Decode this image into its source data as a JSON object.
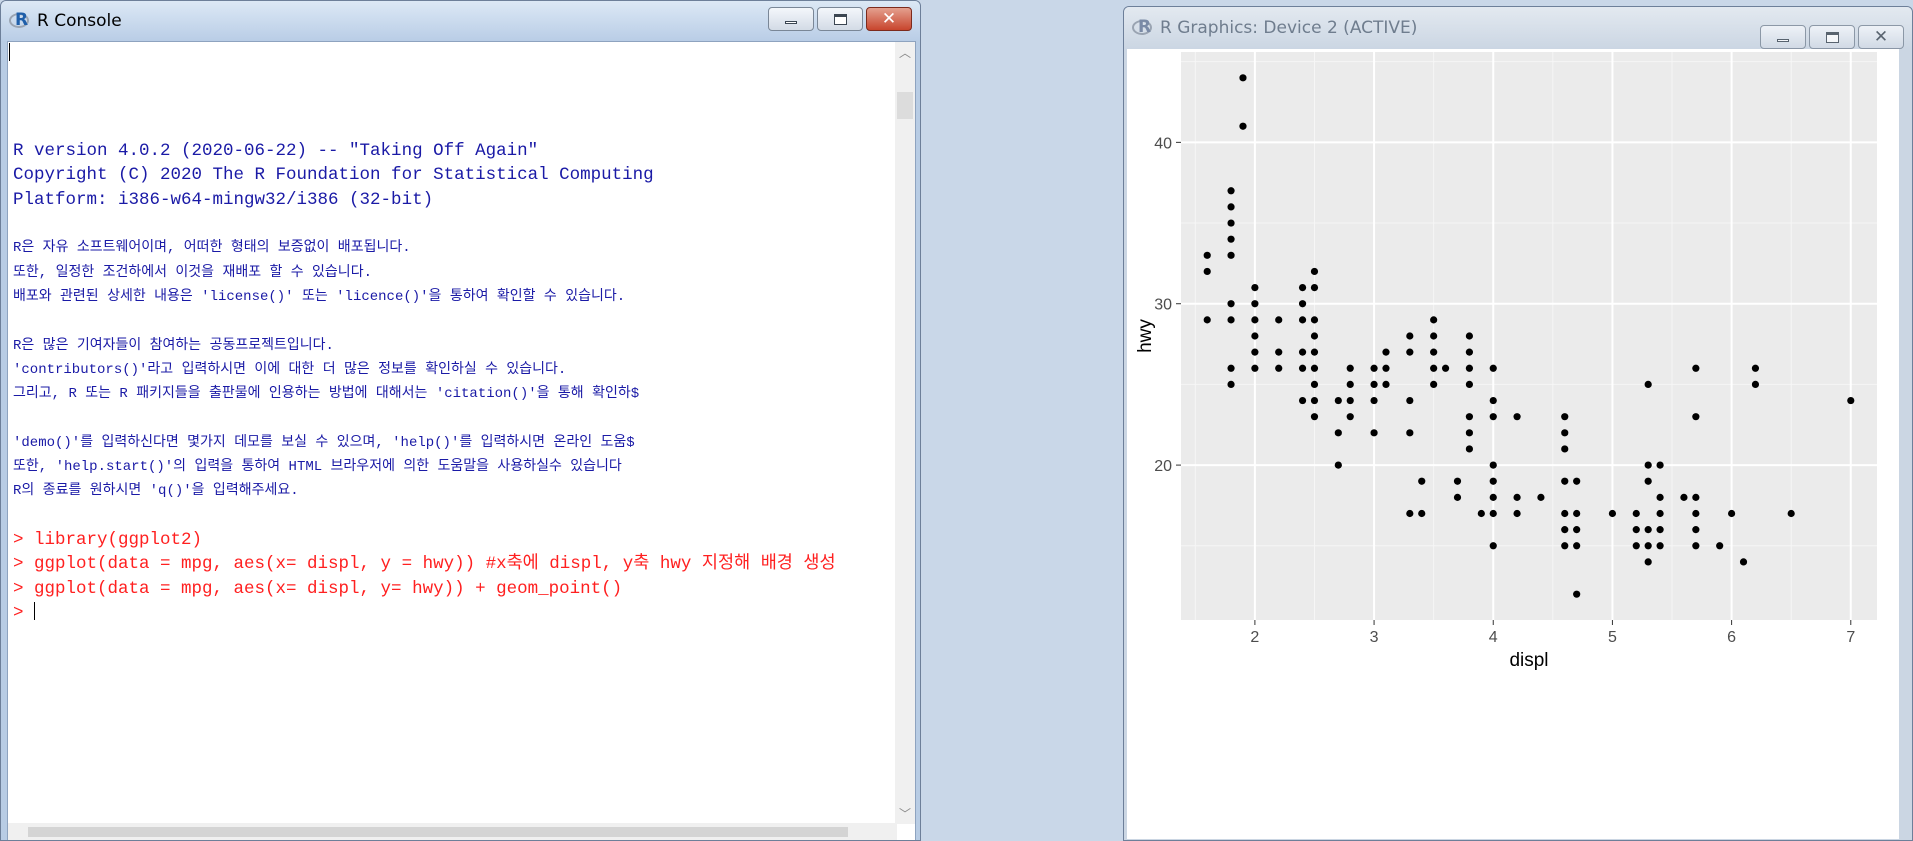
{
  "console_window": {
    "title": "R Console",
    "lines": [
      {
        "text": "",
        "cls": "blue"
      },
      {
        "text": "",
        "cls": "blue"
      },
      {
        "text": "R version 4.0.2 (2020-06-22) -- \"Taking Off Again\"",
        "cls": "blue"
      },
      {
        "text": "Copyright (C) 2020 The R Foundation for Statistical Computing",
        "cls": "blue"
      },
      {
        "text": "Platform: i386-w64-mingw32/i386 (32-bit)",
        "cls": "blue"
      },
      {
        "text": "",
        "cls": "blue"
      },
      {
        "text": "R은 자유 소프트웨어이며, 어떠한 형태의 보증없이 배포됩니다.",
        "cls": "blue small"
      },
      {
        "text": "또한, 일정한 조건하에서 이것을 재배포 할 수 있습니다.",
        "cls": "blue small"
      },
      {
        "text": "배포와 관련된 상세한 내용은 'license()' 또는 'licence()'을 통하여 확인할 수 있습니다.",
        "cls": "blue small"
      },
      {
        "text": "",
        "cls": "blue"
      },
      {
        "text": "R은 많은 기여자들이 참여하는 공동프로젝트입니다.",
        "cls": "blue small"
      },
      {
        "text": "'contributors()'라고 입력하시면 이에 대한 더 많은 정보를 확인하실 수 있습니다.",
        "cls": "blue small"
      },
      {
        "text": "그리고, R 또는 R 패키지들을 출판물에 인용하는 방법에 대해서는 'citation()'을 통해 확인하$",
        "cls": "blue small"
      },
      {
        "text": "",
        "cls": "blue"
      },
      {
        "text": "'demo()'를 입력하신다면 몇가지 데모를 보실 수 있으며, 'help()'를 입력하시면 온라인 도움$",
        "cls": "blue small"
      },
      {
        "text": "또한, 'help.start()'의 입력을 통하여 HTML 브라우저에 의한 도움말을 사용하실수 있습니다",
        "cls": "blue small"
      },
      {
        "text": "R의 종료를 원하시면 'q()'을 입력해주세요.",
        "cls": "blue small"
      },
      {
        "text": "",
        "cls": "blue"
      },
      {
        "text": "> library(ggplot2)",
        "cls": "red"
      },
      {
        "text": "> ggplot(data = mpg, aes(x= displ, y = hwy)) #x축에 displ, y축 hwy 지정해 배경 생성",
        "cls": "red"
      },
      {
        "text": "> ggplot(data = mpg, aes(x= displ, y= hwy)) + geom_point()",
        "cls": "red"
      }
    ],
    "prompt": "> "
  },
  "graphics_window": {
    "title": "R Graphics: Device 2 (ACTIVE)"
  },
  "chart_data": {
    "type": "scatter",
    "title": "",
    "xlabel": "displ",
    "ylabel": "hwy",
    "xlim": [
      1.38,
      7.22
    ],
    "ylim": [
      10.4,
      45.6
    ],
    "xticks": [
      2,
      3,
      4,
      5,
      6,
      7
    ],
    "yticks": [
      20,
      30,
      40
    ],
    "grid": true,
    "panel_background": "#ebebeb",
    "point_color": "#000000",
    "points": [
      [
        1.6,
        29
      ],
      [
        1.6,
        32
      ],
      [
        1.6,
        33
      ],
      [
        1.8,
        25
      ],
      [
        1.8,
        26
      ],
      [
        1.8,
        29
      ],
      [
        1.8,
        30
      ],
      [
        1.8,
        33
      ],
      [
        1.8,
        34
      ],
      [
        1.8,
        35
      ],
      [
        1.8,
        36
      ],
      [
        1.8,
        37
      ],
      [
        1.9,
        41
      ],
      [
        1.9,
        44
      ],
      [
        2.0,
        26
      ],
      [
        2.0,
        27
      ],
      [
        2.0,
        28
      ],
      [
        2.0,
        29
      ],
      [
        2.0,
        30
      ],
      [
        2.0,
        31
      ],
      [
        2.2,
        26
      ],
      [
        2.2,
        27
      ],
      [
        2.2,
        29
      ],
      [
        2.4,
        24
      ],
      [
        2.4,
        26
      ],
      [
        2.4,
        27
      ],
      [
        2.4,
        29
      ],
      [
        2.4,
        30
      ],
      [
        2.4,
        31
      ],
      [
        2.5,
        23
      ],
      [
        2.5,
        24
      ],
      [
        2.5,
        25
      ],
      [
        2.5,
        26
      ],
      [
        2.5,
        27
      ],
      [
        2.5,
        28
      ],
      [
        2.5,
        29
      ],
      [
        2.5,
        31
      ],
      [
        2.5,
        32
      ],
      [
        2.7,
        20
      ],
      [
        2.7,
        22
      ],
      [
        2.7,
        24
      ],
      [
        2.8,
        23
      ],
      [
        2.8,
        24
      ],
      [
        2.8,
        25
      ],
      [
        2.8,
        26
      ],
      [
        3.0,
        22
      ],
      [
        3.0,
        24
      ],
      [
        3.0,
        25
      ],
      [
        3.0,
        26
      ],
      [
        3.1,
        25
      ],
      [
        3.1,
        26
      ],
      [
        3.1,
        27
      ],
      [
        3.3,
        17
      ],
      [
        3.3,
        22
      ],
      [
        3.3,
        24
      ],
      [
        3.3,
        27
      ],
      [
        3.3,
        28
      ],
      [
        3.4,
        17
      ],
      [
        3.4,
        19
      ],
      [
        3.5,
        25
      ],
      [
        3.5,
        26
      ],
      [
        3.5,
        27
      ],
      [
        3.5,
        28
      ],
      [
        3.5,
        29
      ],
      [
        3.6,
        26
      ],
      [
        3.7,
        18
      ],
      [
        3.7,
        19
      ],
      [
        3.8,
        21
      ],
      [
        3.8,
        22
      ],
      [
        3.8,
        23
      ],
      [
        3.8,
        25
      ],
      [
        3.8,
        26
      ],
      [
        3.8,
        27
      ],
      [
        3.8,
        28
      ],
      [
        3.9,
        17
      ],
      [
        4.0,
        15
      ],
      [
        4.0,
        17
      ],
      [
        4.0,
        18
      ],
      [
        4.0,
        19
      ],
      [
        4.0,
        20
      ],
      [
        4.0,
        23
      ],
      [
        4.0,
        24
      ],
      [
        4.0,
        26
      ],
      [
        4.2,
        17
      ],
      [
        4.2,
        18
      ],
      [
        4.2,
        23
      ],
      [
        4.4,
        18
      ],
      [
        4.6,
        15
      ],
      [
        4.6,
        16
      ],
      [
        4.6,
        17
      ],
      [
        4.6,
        19
      ],
      [
        4.6,
        21
      ],
      [
        4.6,
        22
      ],
      [
        4.6,
        23
      ],
      [
        4.7,
        12
      ],
      [
        4.7,
        15
      ],
      [
        4.7,
        16
      ],
      [
        4.7,
        17
      ],
      [
        4.7,
        19
      ],
      [
        5.0,
        17
      ],
      [
        5.2,
        15
      ],
      [
        5.2,
        16
      ],
      [
        5.2,
        17
      ],
      [
        5.3,
        14
      ],
      [
        5.3,
        15
      ],
      [
        5.3,
        16
      ],
      [
        5.3,
        19
      ],
      [
        5.3,
        20
      ],
      [
        5.3,
        25
      ],
      [
        5.4,
        15
      ],
      [
        5.4,
        16
      ],
      [
        5.4,
        17
      ],
      [
        5.4,
        18
      ],
      [
        5.4,
        20
      ],
      [
        5.6,
        18
      ],
      [
        5.7,
        15
      ],
      [
        5.7,
        16
      ],
      [
        5.7,
        17
      ],
      [
        5.7,
        18
      ],
      [
        5.7,
        23
      ],
      [
        5.7,
        26
      ],
      [
        5.9,
        15
      ],
      [
        6.0,
        17
      ],
      [
        6.1,
        14
      ],
      [
        6.2,
        25
      ],
      [
        6.2,
        26
      ],
      [
        6.5,
        17
      ],
      [
        7.0,
        24
      ]
    ]
  }
}
